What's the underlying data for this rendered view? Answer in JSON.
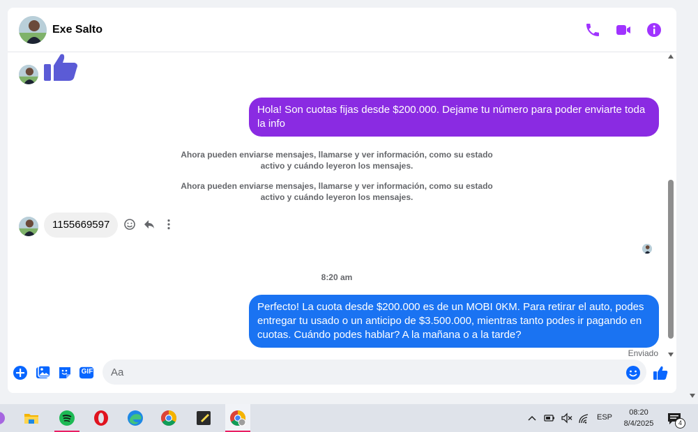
{
  "header": {
    "contact_name": "Exe Salto",
    "icons": [
      "phone-icon",
      "video-icon",
      "info-icon"
    ],
    "accent_color": "#a033ff"
  },
  "messages": {
    "outgoing_1": "Hola! Son cuotas fijas desde $200.000. Dejame tu número para poder enviarte toda la info",
    "system_1": "Ahora pueden enviarse mensajes, llamarse y ver información, como su estado activo y cuándo leyeron los mensajes.",
    "system_2": "Ahora pueden enviarse mensajes, llamarse y ver información, como su estado activo y cuándo leyeron los mensajes.",
    "incoming_1": "1155669597",
    "timestamp": "8:20 am",
    "outgoing_2": "Perfecto! La cuota desde $200.000 es de un MOBI 0KM. Para retirar el auto, podes entregar tu usado o un anticipo de $3.500.000, mientras tanto podes ir pagando en cuotas. Cuándo podes hablar? A la mañana o a la tarde?",
    "status": "Enviado",
    "colors": {
      "outgoing_purple": "#8a2be2",
      "outgoing_blue": "#1a73f2",
      "incoming_bg": "#f0f0f0"
    }
  },
  "composer": {
    "placeholder": "Aa",
    "icons": [
      "plus-icon",
      "image-icon",
      "sticker-icon",
      "gif-icon",
      "emoji-icon",
      "like-icon"
    ],
    "gif_label": "GIF",
    "accent_color": "#0866ff"
  },
  "taskbar": {
    "apps": [
      "partial-app-icon",
      "file-explorer-icon",
      "spotify-icon",
      "opera-icon",
      "edge-icon",
      "chrome-icon",
      "sticky-notes-icon",
      "chrome-profile-icon"
    ],
    "tray_icons": [
      "chevron-up-icon",
      "battery-icon",
      "speaker-muted-icon",
      "wifi-icon"
    ],
    "language": "ESP",
    "time": "08:20",
    "date": "8/4/2025",
    "notification_count": "4"
  }
}
